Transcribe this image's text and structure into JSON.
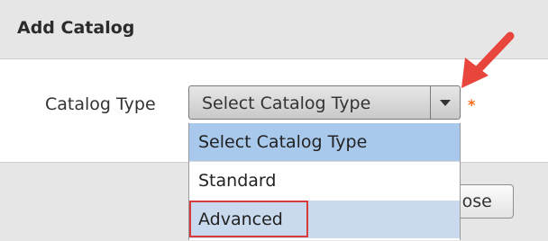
{
  "dialog": {
    "title": "Add Catalog",
    "field": {
      "label": "Catalog Type",
      "selected_value": "Select Catalog Type",
      "required_marker": "*"
    },
    "dropdown": {
      "options": [
        "Select Catalog Type",
        "Standard",
        "Advanced"
      ],
      "hovered_option": "Select Catalog Type",
      "highlighted_option": "Advanced"
    },
    "footer": {
      "close_label": "Close"
    }
  },
  "annotations": {
    "arrow_color": "#e8463c",
    "highlight_color": "#d93a3a"
  },
  "icons": {
    "select_arrow": "caret-down-icon",
    "pointer": "red-arrow-annotation"
  }
}
